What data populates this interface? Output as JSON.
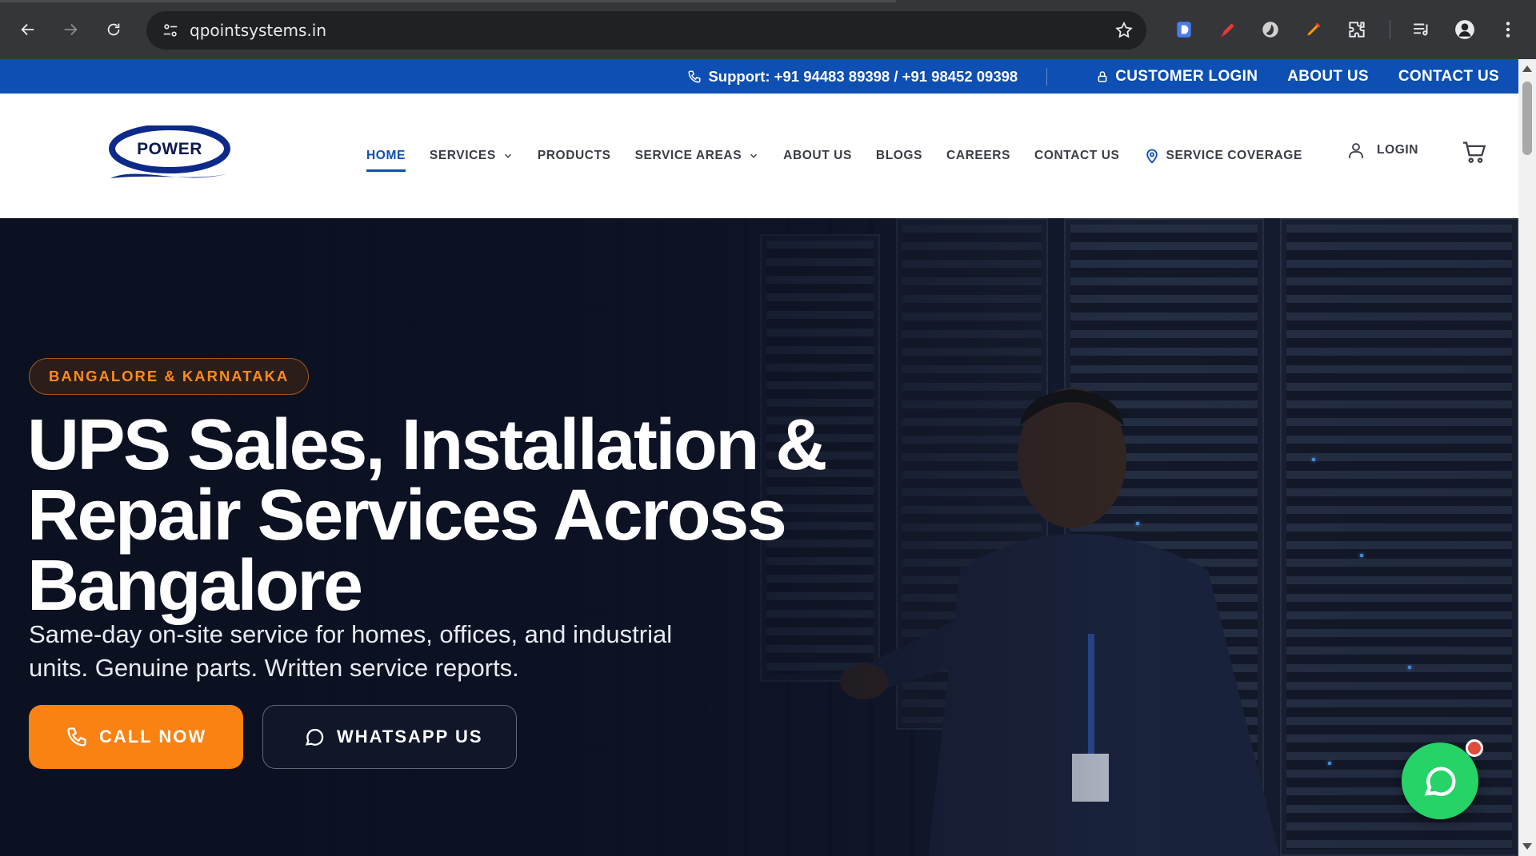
{
  "browser": {
    "url": "qpointsystems.in"
  },
  "topbar": {
    "support": "Support: +91 94483 89398 / +91 98452 09398",
    "customer_login": "CUSTOMER LOGIN",
    "about": "ABOUT US",
    "contact": "CONTACT US"
  },
  "logo": {
    "text": "POWER"
  },
  "nav": {
    "home": "HOME",
    "services": "SERVICES",
    "products": "PRODUCTS",
    "service_areas": "SERVICE AREAS",
    "about": "ABOUT US",
    "blogs": "BLOGS",
    "careers": "CAREERS",
    "contact": "CONTACT US",
    "coverage": "SERVICE COVERAGE",
    "login": "LOGIN"
  },
  "hero": {
    "badge": "BANGALORE & KARNATAKA",
    "title_line1": "UPS Sales, Installation &",
    "title_line2": "Repair Services Across",
    "title_line3": "Bangalore",
    "subtitle_line1": "Same-day on-site service for homes, offices, and industrial",
    "subtitle_line2": "units. Genuine parts. Written service reports.",
    "call_label": "CALL NOW",
    "whatsapp_label": "WHATSAPP US"
  },
  "colors": {
    "brand_blue": "#0d4fb3",
    "accent_orange": "#f98212",
    "whatsapp_green": "#25d366"
  }
}
